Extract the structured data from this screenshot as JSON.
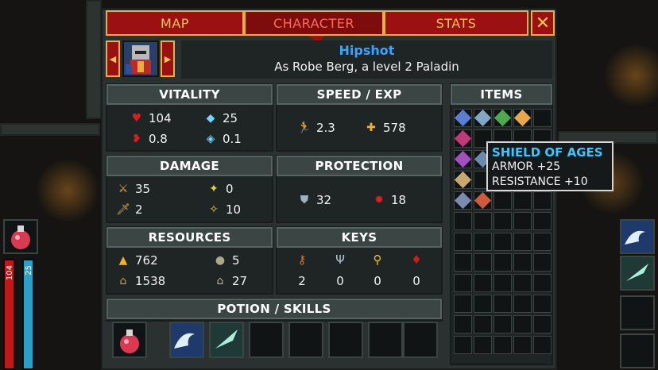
{
  "tabs": [
    {
      "label": "MAP",
      "active": false
    },
    {
      "label": "CHARACTER",
      "active": true
    },
    {
      "label": "STATS",
      "active": false
    }
  ],
  "close_label": "✕",
  "hero": {
    "name": "Hipshot",
    "subtitle": "As Robe Berg, a level 2 Paladin"
  },
  "vitality": {
    "title": "VITALITY",
    "health": "104",
    "mana": "25",
    "health_regen": "0.8",
    "mana_regen": "0.1"
  },
  "speed": {
    "title": "SPEED / EXP",
    "speed": "2.3",
    "exp": "578"
  },
  "damage": {
    "title": "DAMAGE",
    "melee": "35",
    "magic": "0",
    "melee_bonus": "2",
    "magic_bonus": "10"
  },
  "protection": {
    "title": "PROTECTION",
    "armor": "32",
    "resistance": "18"
  },
  "resources": {
    "title": "RESOURCES",
    "gold": "762",
    "stone": "5",
    "houses": "1538",
    "stone_houses": "27"
  },
  "keys": {
    "title": "KEYS",
    "values": [
      "2",
      "0",
      "0",
      "0"
    ]
  },
  "potion": {
    "title": "POTION / SKILLS"
  },
  "items": {
    "title": "ITEMS"
  },
  "tooltip": {
    "title": "SHIELD OF AGES",
    "armor": "ARMOR +25",
    "resistance": "RESISTANCE +10"
  },
  "side": {
    "health": "104",
    "mana": "25"
  },
  "colors": {
    "tab": "#9b1111",
    "tab_border": "#e8b03a",
    "accent_blue": "#3aa3ff"
  }
}
